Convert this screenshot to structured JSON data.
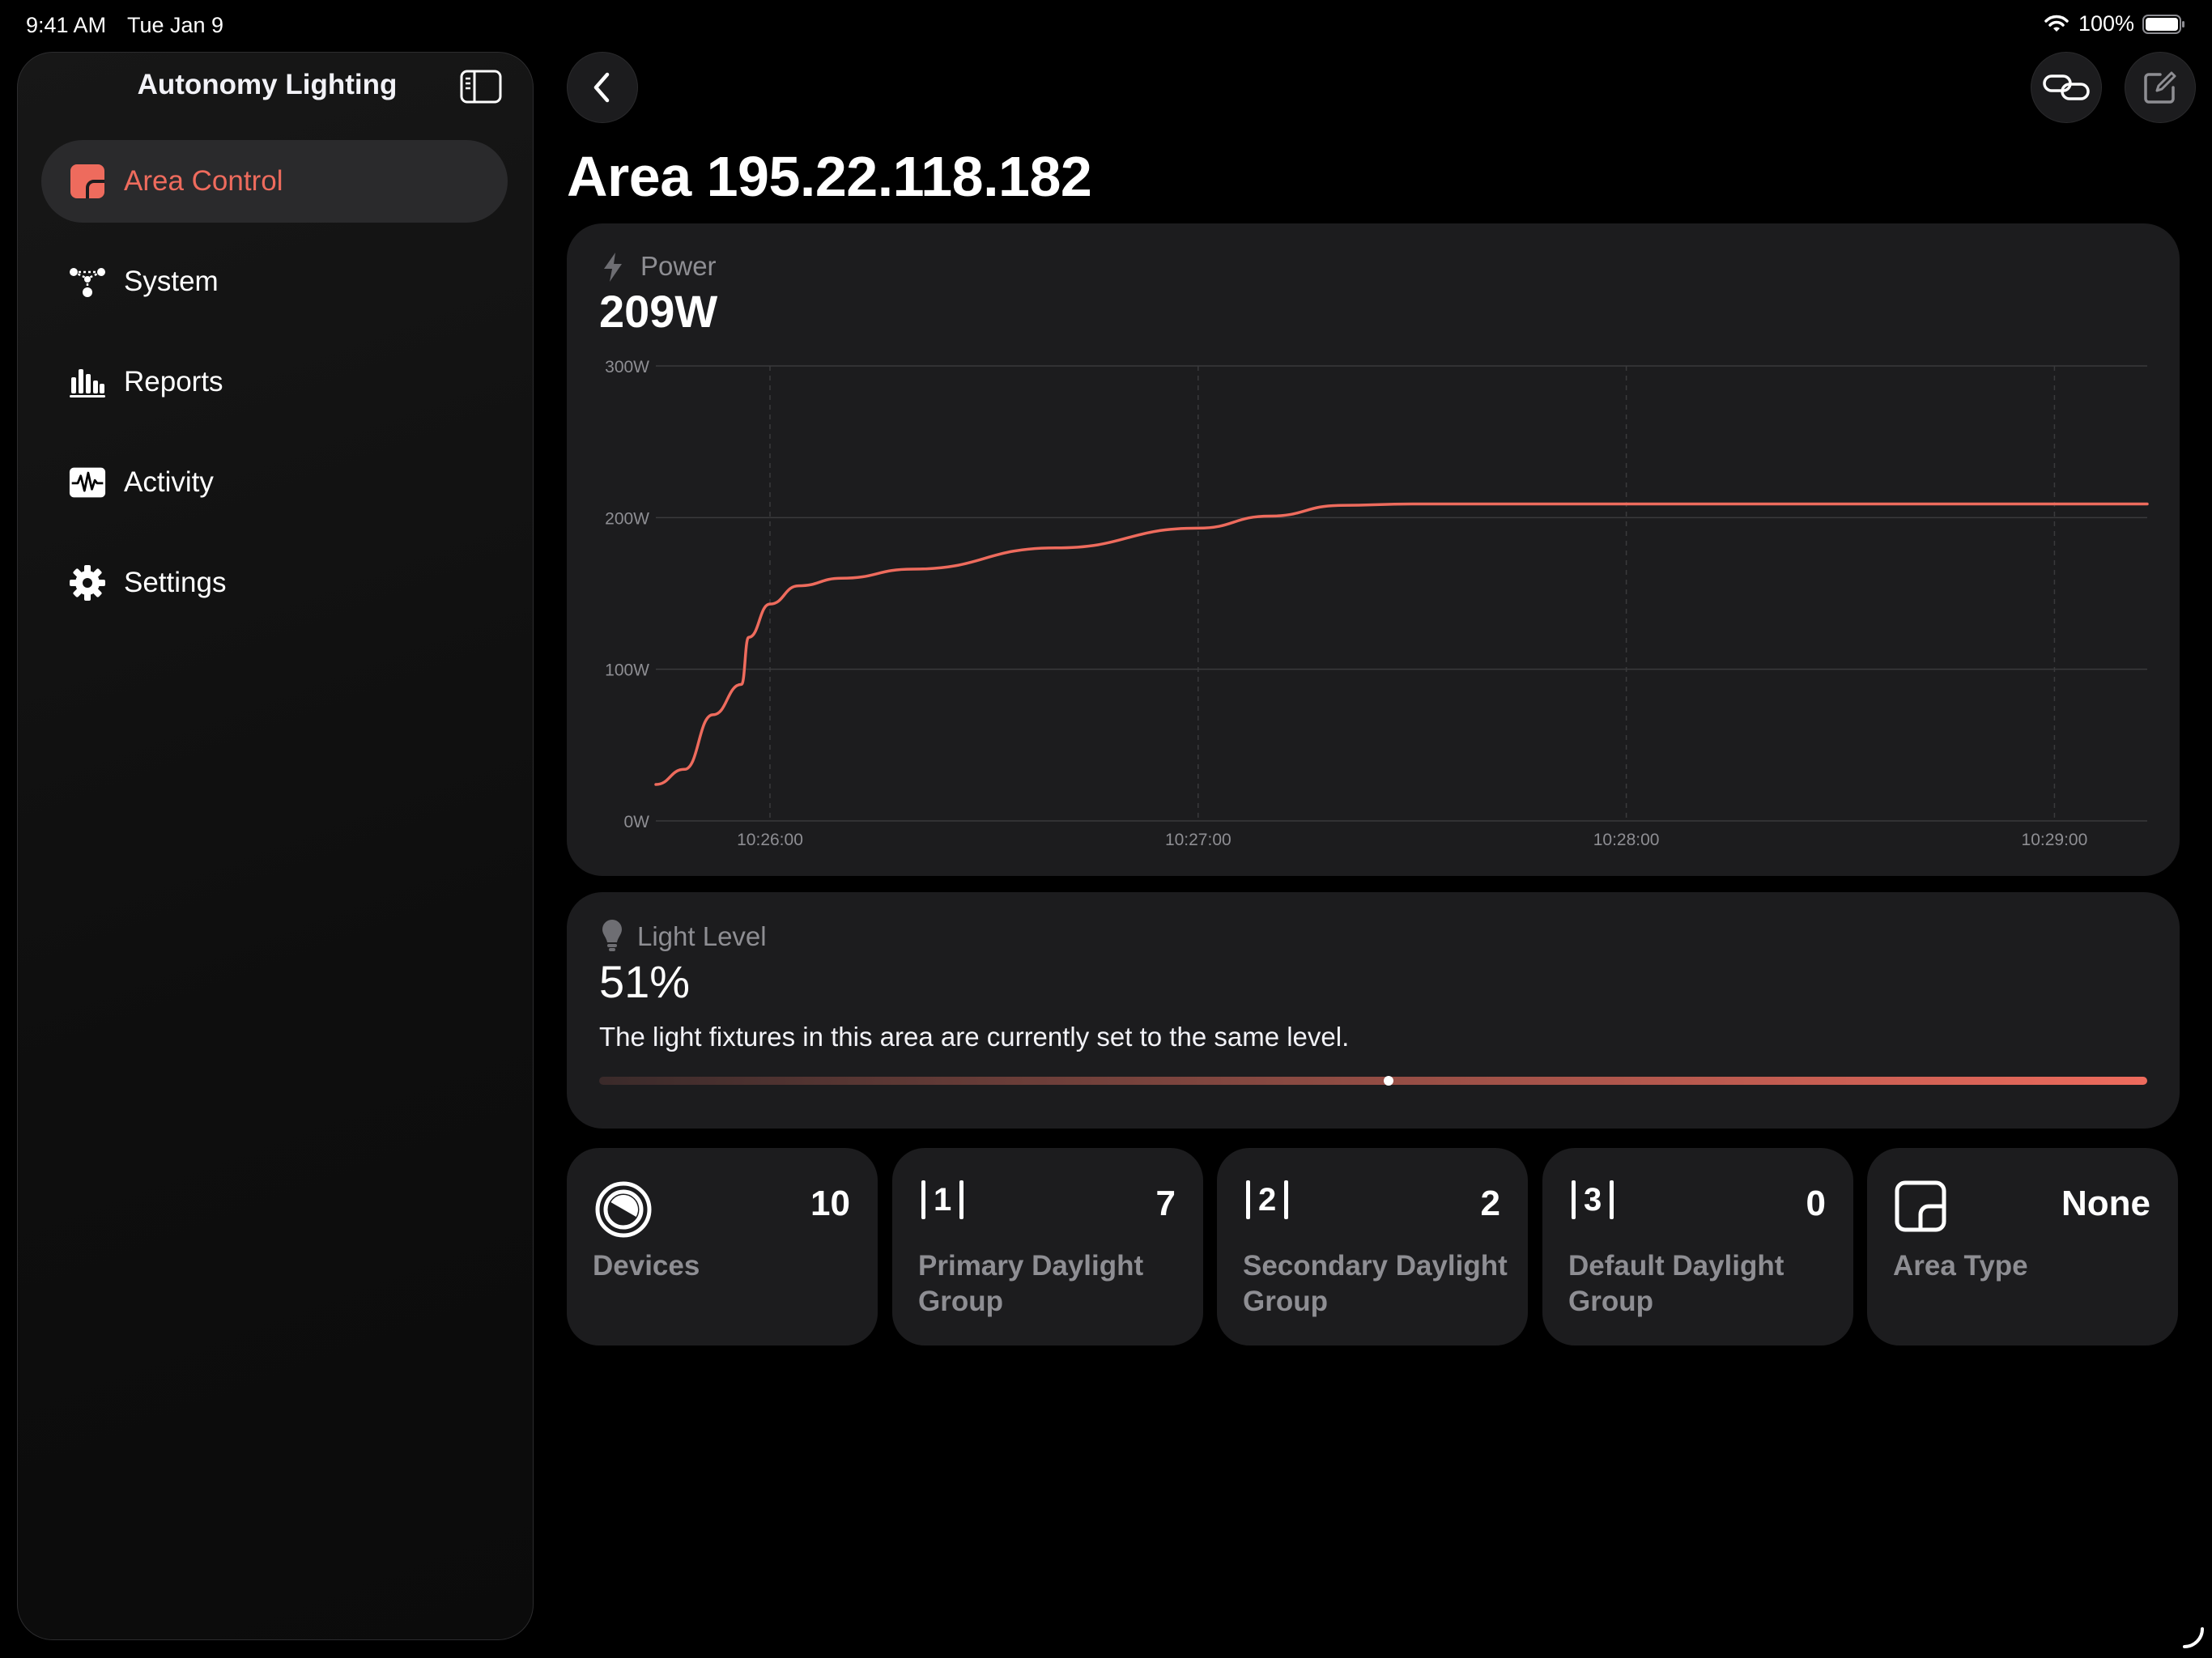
{
  "status": {
    "time": "9:41 AM",
    "date": "Tue Jan 9",
    "battery": "100%"
  },
  "sidebar": {
    "title": "Autonomy Lighting",
    "items": [
      {
        "label": "Area Control",
        "icon": "area-control-icon",
        "active": true
      },
      {
        "label": "System",
        "icon": "system-network-icon"
      },
      {
        "label": "Reports",
        "icon": "reports-chart-icon"
      },
      {
        "label": "Activity",
        "icon": "activity-waveform-icon"
      },
      {
        "label": "Settings",
        "icon": "gear-icon"
      }
    ]
  },
  "header": {
    "title": "Area 195.22.118.182"
  },
  "power": {
    "label": "Power",
    "value": "209W",
    "chart_data": {
      "type": "line",
      "title": "",
      "xlabel": "",
      "ylabel": "",
      "y_ticks": [
        "0W",
        "100W",
        "200W",
        "300W"
      ],
      "x_ticks": [
        "10:26:00",
        "10:27:00",
        "10:28:00",
        "10:29:00"
      ],
      "ylim": [
        0,
        300
      ],
      "xlim": [
        "10:25:44",
        "10:29:13"
      ],
      "grid": true,
      "color": "#ee6b5d",
      "series": [
        {
          "x": [
            "10:25:44",
            "10:25:48",
            "10:25:52",
            "10:25:56",
            "10:25:57",
            "10:26:00",
            "10:26:04",
            "10:26:10",
            "10:26:20",
            "10:26:40",
            "10:27:00",
            "10:27:10",
            "10:27:20",
            "10:27:30",
            "10:28:00",
            "10:28:30",
            "10:29:00",
            "10:29:13"
          ],
          "y": [
            24,
            34,
            70,
            90,
            121,
            143,
            155,
            160,
            166,
            180,
            193,
            201,
            208,
            209,
            209,
            209,
            209,
            209
          ]
        }
      ]
    }
  },
  "light_level": {
    "label": "Light Level",
    "value": "51%",
    "level": 0.51,
    "description": "The light fixtures in this area are currently set to the same level."
  },
  "tiles": [
    {
      "count": "10",
      "label": "Devices",
      "icon": "devices-icon"
    },
    {
      "count": "7",
      "label": "Primary Daylight Group",
      "group": "1"
    },
    {
      "count": "2",
      "label": "Secondary Daylight Group",
      "group": "2"
    },
    {
      "count": "0",
      "label": "Default Daylight Group",
      "group": "3"
    },
    {
      "count": "None",
      "label": "Area Type",
      "icon": "area-type-icon"
    }
  ]
}
